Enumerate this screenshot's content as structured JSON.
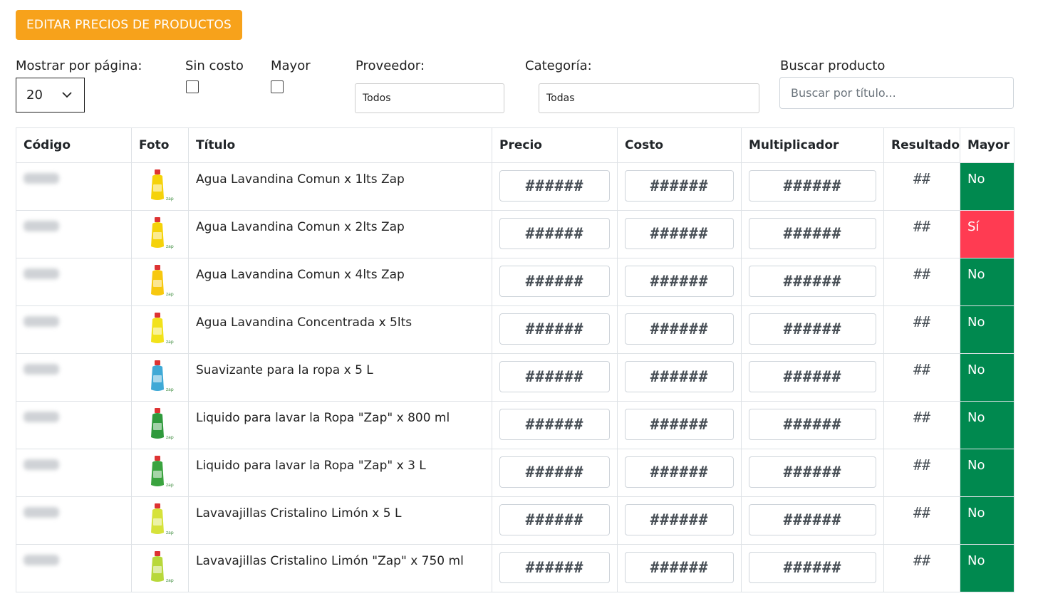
{
  "header": {
    "edit_button": "EDITAR PRECIOS DE PRODUCTOS"
  },
  "filters": {
    "per_page_label": "Mostrar por página:",
    "per_page_value": "20",
    "sin_costo_label": "Sin costo",
    "mayor_label": "Mayor",
    "proveedor_label": "Proveedor:",
    "proveedor_value": "Todos",
    "categoria_label": "Categoría:",
    "categoria_value": "Todas",
    "search_label": "Buscar producto",
    "search_placeholder": "Buscar por título..."
  },
  "table": {
    "headers": [
      "Código",
      "Foto",
      "Título",
      "Precio",
      "Costo",
      "Multiplicador",
      "Resultado",
      "Mayor"
    ],
    "rows": [
      {
        "title": "Agua Lavandina Comun x 1lts Zap",
        "precio": "######",
        "costo": "######",
        "mult": "######",
        "resultado": "##",
        "mayor": "No"
      },
      {
        "title": "Agua Lavandina Comun x 2lts Zap",
        "precio": "######",
        "costo": "######",
        "mult": "######",
        "resultado": "##",
        "mayor": "Sí"
      },
      {
        "title": "Agua Lavandina Comun x 4lts Zap",
        "precio": "######",
        "costo": "######",
        "mult": "######",
        "resultado": "##",
        "mayor": "No"
      },
      {
        "title": "Agua Lavandina Concentrada x 5lts",
        "precio": "######",
        "costo": "######",
        "mult": "######",
        "resultado": "##",
        "mayor": "No"
      },
      {
        "title": "Suavizante para la ropa x 5 L",
        "precio": "######",
        "costo": "######",
        "mult": "######",
        "resultado": "##",
        "mayor": "No"
      },
      {
        "title": "Liquido para lavar la Ropa \"Zap\" x 800 ml",
        "precio": "######",
        "costo": "######",
        "mult": "######",
        "resultado": "##",
        "mayor": "No"
      },
      {
        "title": "Liquido para lavar la Ropa \"Zap\" x 3 L",
        "precio": "######",
        "costo": "######",
        "mult": "######",
        "resultado": "##",
        "mayor": "No"
      },
      {
        "title": "Lavavajillas Cristalino Limón x 5 L",
        "precio": "######",
        "costo": "######",
        "mult": "######",
        "resultado": "##",
        "mayor": "No"
      },
      {
        "title": "Lavavajillas Cristalino Limón \"Zap\" x 750 ml",
        "precio": "######",
        "costo": "######",
        "mult": "######",
        "resultado": "##",
        "mayor": "No"
      }
    ]
  },
  "colors": {
    "accent": "#f7a21b",
    "mayor_no": "#00894f",
    "mayor_si": "#ff3b52"
  }
}
